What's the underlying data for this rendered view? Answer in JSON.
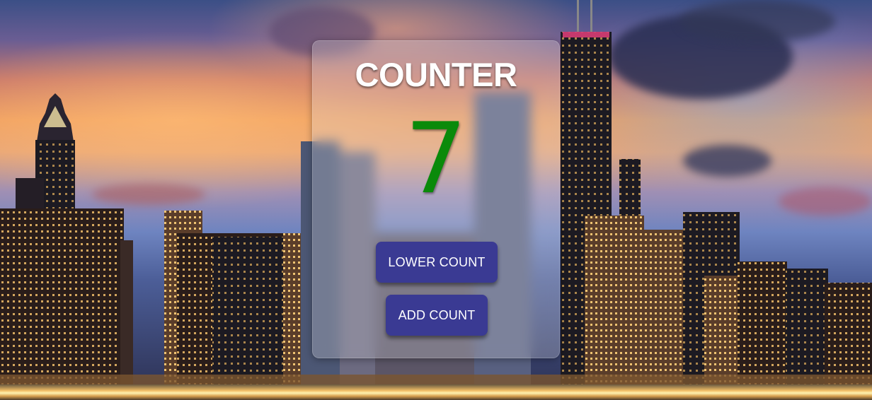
{
  "counter": {
    "title": "COUNTER",
    "value": "7",
    "value_color": "#0a8a0a"
  },
  "buttons": {
    "lower_label": "LOWER COUNT",
    "add_label": "ADD COUNT",
    "color": "#3a3a93"
  }
}
